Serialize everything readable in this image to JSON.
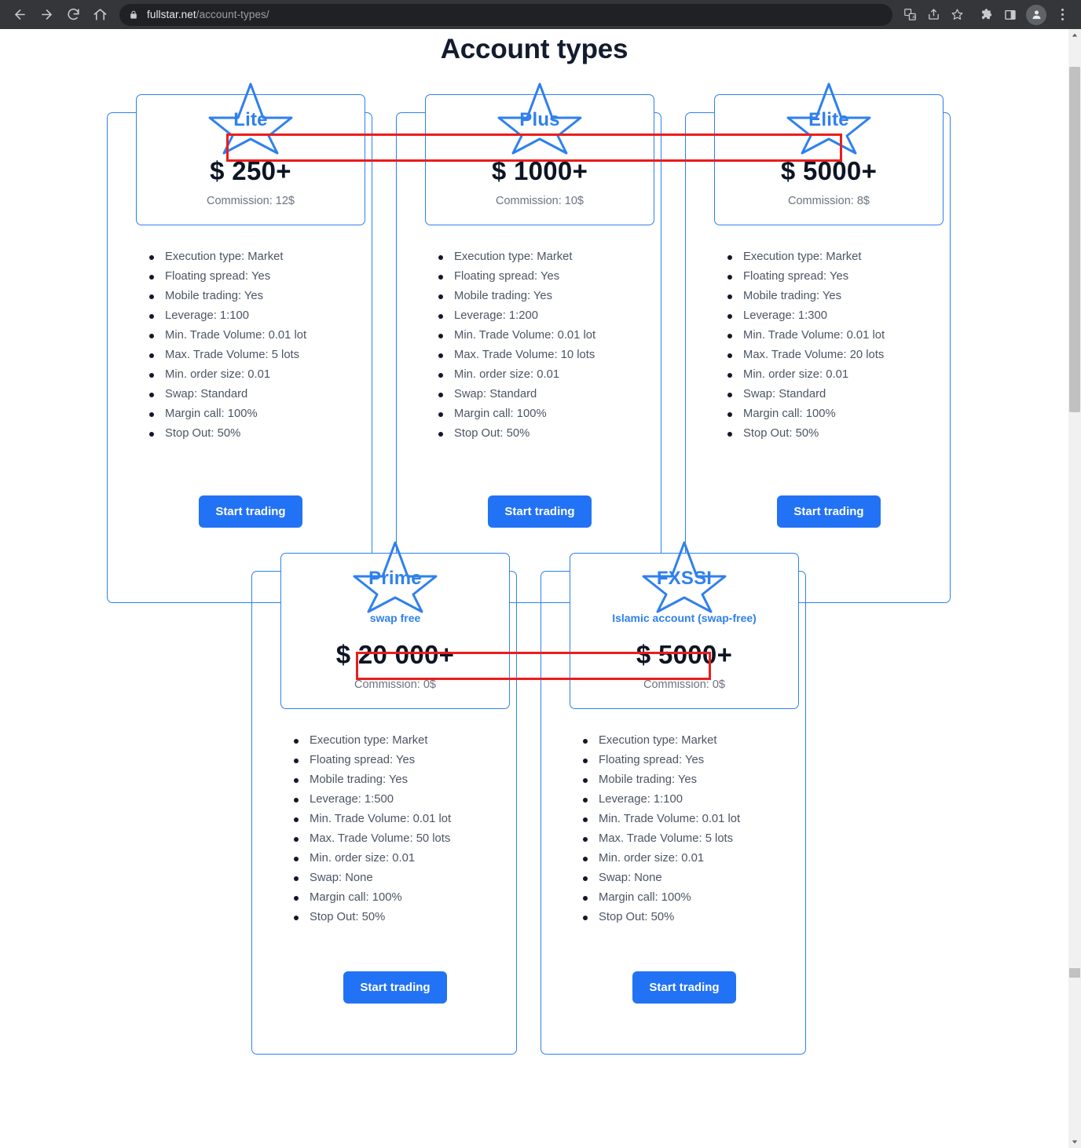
{
  "browser": {
    "back_icon": "back-arrow-icon",
    "forward_icon": "forward-arrow-icon",
    "reload_icon": "reload-icon",
    "home_icon": "home-icon",
    "lock_icon": "lock-icon",
    "url_domain": "fullstar.net",
    "url_path": "/account-types/",
    "translate_icon": "translate-icon",
    "share_icon": "share-icon",
    "bookmark_icon": "bookmark-star-icon",
    "extensions_icon": "extensions-puzzle-icon",
    "side_panel_icon": "side-panel-icon",
    "profile_icon": "profile-avatar-icon",
    "menu_icon": "three-dot-menu-icon"
  },
  "page": {
    "title": "Account types",
    "accent_blue": "#2f80ed",
    "button_blue": "#2272f5",
    "annotation_red": "#ec1c1c",
    "title_color": "#131b2e"
  },
  "cta_label": "Start trading",
  "cards": [
    {
      "name": "Lite",
      "subtitle": "",
      "price": "$ 250+",
      "commission": "Commission: 12$",
      "features": [
        "Execution type: Market",
        "Floating spread: Yes",
        "Mobile trading: Yes",
        "Leverage: 1:100",
        "Min. Trade Volume: 0.01 lot",
        "Max. Trade Volume: 5 lots",
        "Min. order size: 0.01",
        "Swap: Standard",
        "Margin call: 100%",
        "Stop Out: 50%"
      ],
      "cta": "Start trading"
    },
    {
      "name": "Plus",
      "subtitle": "",
      "price": "$ 1000+",
      "commission": "Commission: 10$",
      "features": [
        "Execution type: Market",
        "Floating spread: Yes",
        "Mobile trading: Yes",
        "Leverage: 1:200",
        "Min. Trade Volume: 0.01 lot",
        "Max. Trade Volume: 10 lots",
        "Min. order size: 0.01",
        "Swap: Standard",
        "Margin call: 100%",
        "Stop Out: 50%"
      ],
      "cta": "Start trading"
    },
    {
      "name": "Elite",
      "subtitle": "",
      "price": "$ 5000+",
      "commission": "Commission: 8$",
      "features": [
        "Execution type: Market",
        "Floating spread: Yes",
        "Mobile trading: Yes",
        "Leverage: 1:300",
        "Min. Trade Volume: 0.01 lot",
        "Max. Trade Volume: 20 lots",
        "Min. order size: 0.01",
        "Swap: Standard",
        "Margin call: 100%",
        "Stop Out: 50%"
      ],
      "cta": "Start trading"
    },
    {
      "name": "Prime",
      "subtitle": "swap free",
      "price": "$ 20 000+",
      "commission": "Commission: 0$",
      "features": [
        "Execution type: Market",
        "Floating spread: Yes",
        "Mobile trading: Yes",
        "Leverage: 1:500",
        "Min. Trade Volume: 0.01 lot",
        "Max. Trade Volume: 50 lots",
        "Min. order size: 0.01",
        "Swap: None",
        "Margin call: 100%",
        "Stop Out: 50%"
      ],
      "cta": "Start trading"
    },
    {
      "name": "FXSSI",
      "subtitle": "Islamic account (swap-free)",
      "price": "$ 5000+",
      "commission": "Commission: 0$",
      "features": [
        "Execution type: Market",
        "Floating spread: Yes",
        "Mobile trading: Yes",
        "Leverage: 1:100",
        "Min. Trade Volume: 0.01 lot",
        "Max. Trade Volume: 5 lots",
        "Min. order size: 0.01",
        "Swap: None",
        "Margin call: 100%",
        "Stop Out: 50%"
      ],
      "cta": "Start trading"
    }
  ]
}
